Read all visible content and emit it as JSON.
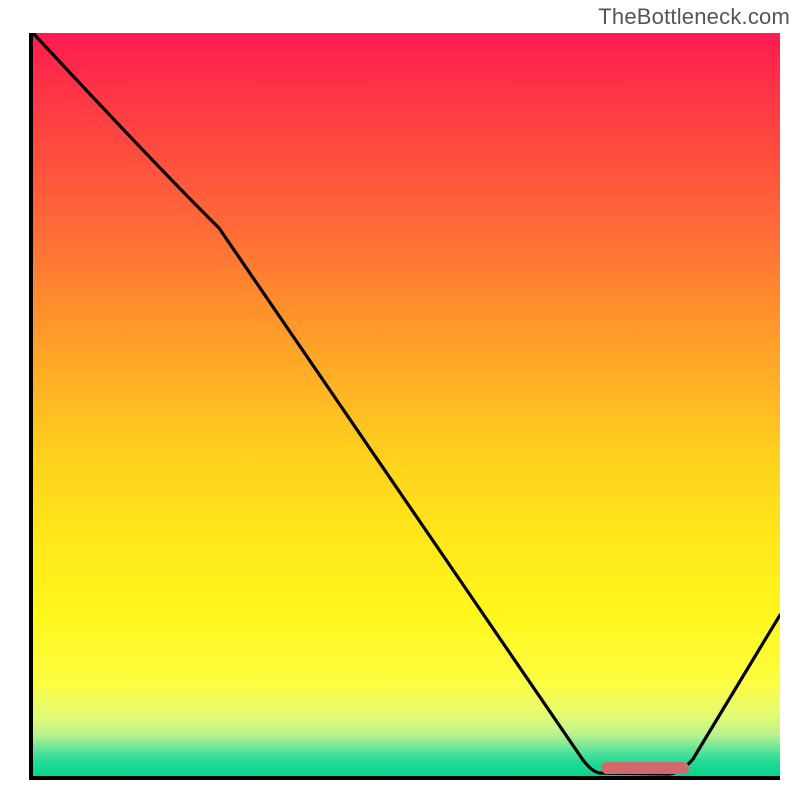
{
  "credit": "TheBottleneck.com",
  "chart_data": {
    "type": "line",
    "title": "",
    "xlabel": "",
    "ylabel": "",
    "xlim": [
      0,
      100
    ],
    "ylim": [
      0,
      100
    ],
    "grid": false,
    "legend": null,
    "series": [
      {
        "name": "curve",
        "x": [
          0,
          25,
          74,
          76,
          79,
          85,
          100
        ],
        "y": [
          100,
          74,
          2.5,
          1.0,
          0.6,
          0.8,
          22
        ],
        "notes": "Steep descent, slope break near x≈25 (segment boundary), flat valley x≈74–86, rise to right edge."
      }
    ],
    "marker": {
      "name": "valley-band",
      "x_start": 76,
      "x_end": 87,
      "y": 0.8,
      "color": "#d1696b"
    },
    "background_gradient": {
      "top": "#ff1a51",
      "mid": "#ffd41a",
      "bottom": "#00d18b"
    },
    "colors": {
      "axis": "#000000",
      "curve": "#000000",
      "credit_text": "#555555"
    }
  }
}
